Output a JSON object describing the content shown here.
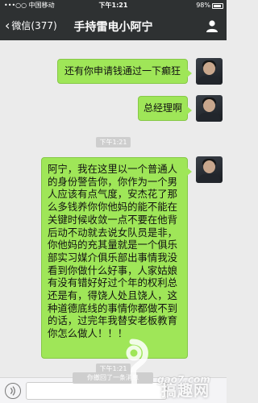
{
  "status_bar": {
    "carrier": "•••○○ 中国移动",
    "time": "下午1:21",
    "battery": "98%"
  },
  "nav": {
    "back_label": "微信(377)",
    "title": "手持雷电小阿宁"
  },
  "messages": [
    {
      "text": "还有你申请钱通过一下癫狂"
    },
    {
      "text": "总经理啊"
    },
    {
      "text": "阿宁，我在这里以一个普通人的身份警告你，你作为一个男人应该有点气度，安杰花了那么多钱养你你他妈的能不能在关键时候收敛一点不要在他背后动不动就去说女队员是非，你他妈的充其量就是一个俱乐部实习媒介俱乐部出事情我没看到你做什么好事，人家姑娘有没有错好好过个年的权利总还是有，得饶人处且饶人，这种道德底线的事情你都做不到的话，过完年我替安老板教育你怎么做人！！！"
    }
  ],
  "timestamps": {
    "t1": "下午1:21",
    "t2": "下午1:21"
  },
  "system_notice": "你撤回了一条消息",
  "watermark": {
    "domain": "gao7.com",
    "name": "搞趣网"
  },
  "colors": {
    "nav_bg": "#2e3132",
    "bubble": "#9fe658",
    "chat_bg": "#ebebeb"
  }
}
